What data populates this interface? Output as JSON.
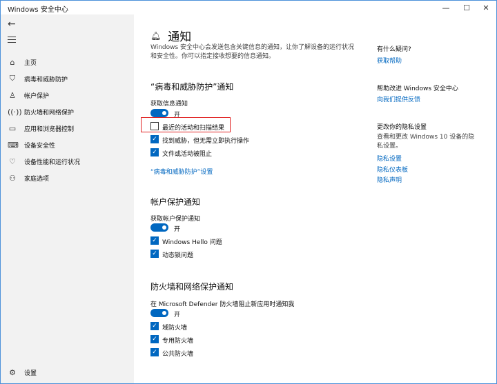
{
  "titlebar": {
    "title": "Windows 安全中心",
    "minimize": "—",
    "maximize": "☐",
    "close": "✕"
  },
  "sidebar": {
    "back": "←",
    "items": [
      {
        "label": "主页",
        "icon": "home-icon"
      },
      {
        "label": "病毒和威胁防护",
        "icon": "shield-icon"
      },
      {
        "label": "帐户保护",
        "icon": "person-icon"
      },
      {
        "label": "防火墙和网络保护",
        "icon": "wifi-icon"
      },
      {
        "label": "应用和浏览器控制",
        "icon": "window-icon"
      },
      {
        "label": "设备安全性",
        "icon": "laptop-icon"
      },
      {
        "label": "设备性能和运行状况",
        "icon": "heart-icon"
      },
      {
        "label": "家庭选项",
        "icon": "family-icon"
      }
    ],
    "settings_label": "设置"
  },
  "main": {
    "title": "通知",
    "description": "Windows 安全中心会发送包含关键信息的通知，让你了解设备的运行状况和安全性。你可以指定接收想要的信息通知。",
    "virus": {
      "title": "“病毒和威胁防护”通知",
      "get_info": "获取信息通知",
      "toggle": "开",
      "checks": [
        {
          "label": "最近的活动和扫描结果",
          "checked": false
        },
        {
          "label": "找到威胁，但无需立即执行操作",
          "checked": true
        },
        {
          "label": "文件或活动被阻止",
          "checked": true
        }
      ],
      "settings_link": "“病毒和威胁防护”设置"
    },
    "account": {
      "title": "帐户保护通知",
      "get_info": "获取帐户保护通知",
      "toggle": "开",
      "checks": [
        {
          "label": "Windows Hello 问题",
          "checked": true
        },
        {
          "label": "动态锁问题",
          "checked": true
        }
      ]
    },
    "firewall": {
      "title": "防火墙和网络保护通知",
      "get_info": "在 Microsoft Defender 防火墙阻止新应用时通知我",
      "toggle": "开",
      "checks": [
        {
          "label": "域防火墙",
          "checked": true
        },
        {
          "label": "专用防火墙",
          "checked": true
        },
        {
          "label": "公共防火墙",
          "checked": true
        }
      ]
    }
  },
  "right": {
    "q_title": "有什么疑问?",
    "q_link": "获取帮助",
    "improve_title": "帮助改进 Windows 安全中心",
    "improve_link": "向我们提供反馈",
    "privacy_title": "更改你的隐私设置",
    "privacy_text": "查看和更改 Windows 10 设备的隐私设置。",
    "privacy_links": [
      "隐私设置",
      "隐私仪表板",
      "隐私声明"
    ]
  },
  "colors": {
    "accent": "#0067c0",
    "highlight": "#e02020",
    "sidebar_bg": "#f2f2f2"
  }
}
